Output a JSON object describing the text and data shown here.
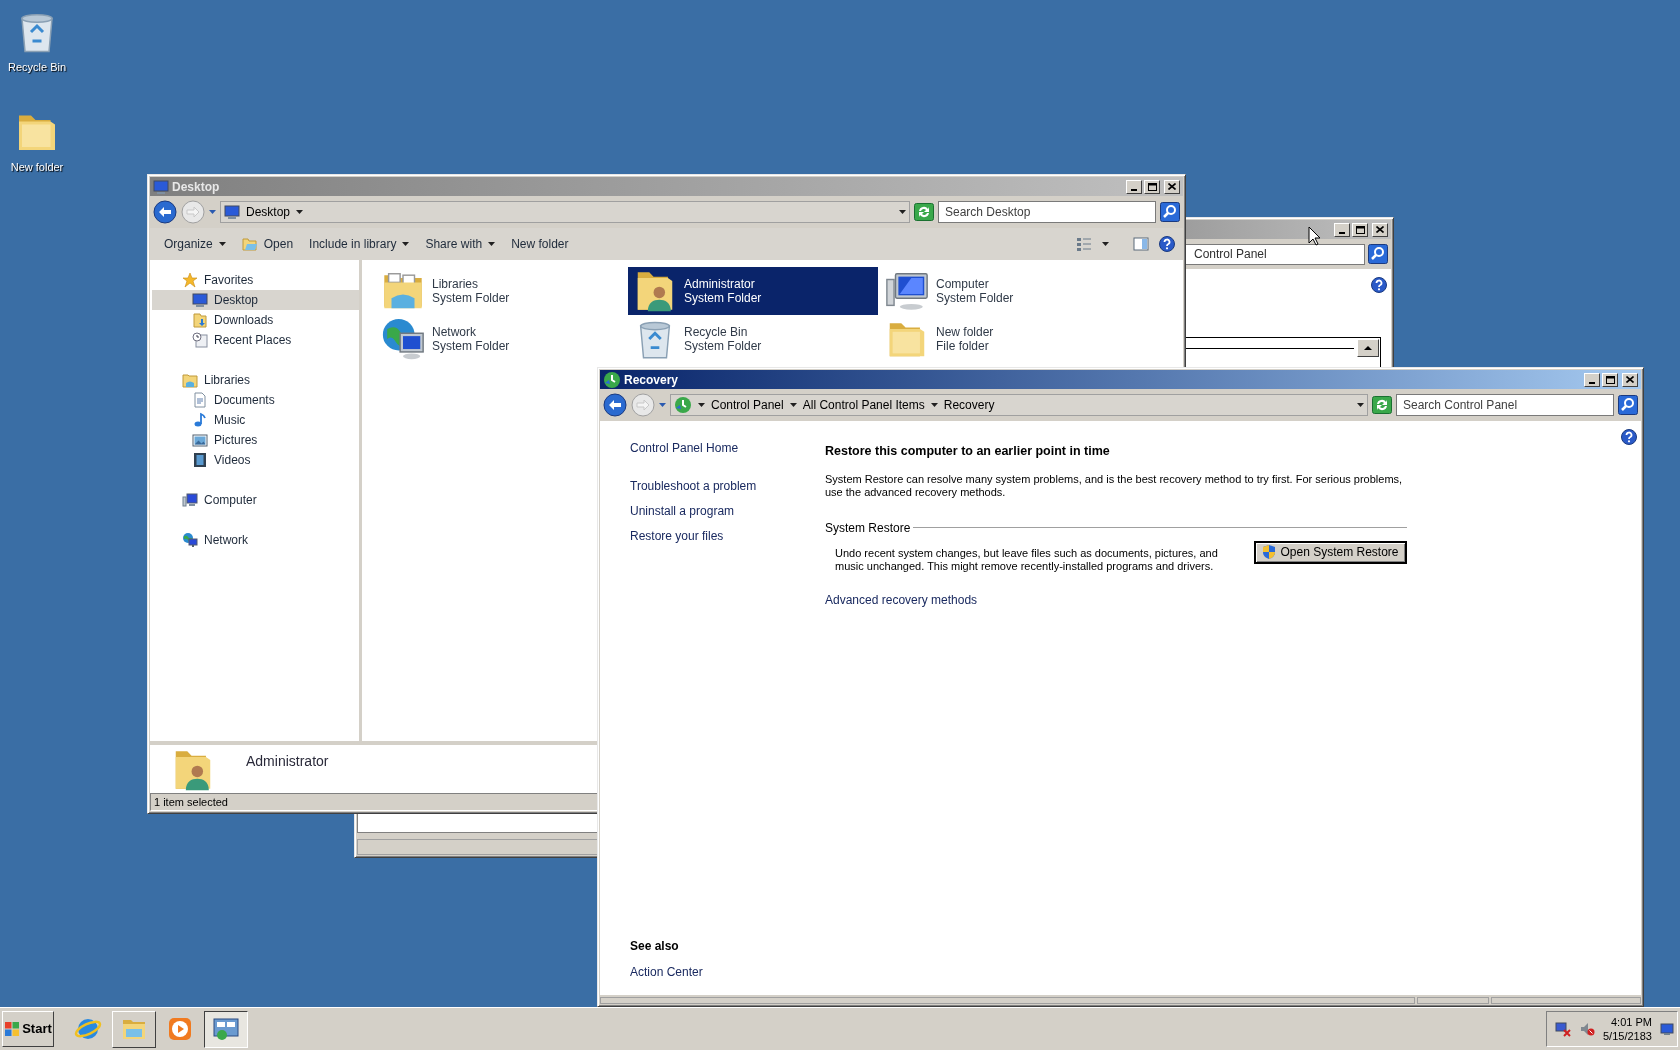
{
  "desktop_icons": [
    {
      "label": "Recycle Bin"
    },
    {
      "label": "New folder"
    }
  ],
  "background_window": {
    "search": {
      "placeholder": "Control Panel"
    }
  },
  "explorer_window": {
    "title": "Desktop",
    "active": false,
    "address": "Desktop",
    "search": {
      "placeholder": "Search Desktop"
    },
    "toolbar": [
      {
        "label": "Organize",
        "kind": "menu"
      },
      {
        "label": "Open",
        "kind": "command"
      },
      {
        "label": "Include in library",
        "kind": "menu"
      },
      {
        "label": "Share with",
        "kind": "menu"
      },
      {
        "label": "New folder",
        "kind": "plain"
      }
    ],
    "nav": [
      {
        "label": "Favorites",
        "selected": false,
        "children": [
          {
            "label": "Desktop",
            "selected": true
          },
          {
            "label": "Downloads",
            "selected": false
          },
          {
            "label": "Recent Places",
            "selected": false
          }
        ]
      },
      {
        "label": "Libraries",
        "selected": false,
        "children": [
          {
            "label": "Documents",
            "selected": false
          },
          {
            "label": "Music",
            "selected": false
          },
          {
            "label": "Pictures",
            "selected": false
          },
          {
            "label": "Videos",
            "selected": false
          }
        ]
      },
      {
        "label": "Computer",
        "selected": false
      },
      {
        "label": "Network",
        "selected": false
      }
    ],
    "items": [
      {
        "name": "Libraries",
        "type": "System Folder",
        "selected": false
      },
      {
        "name": "Administrator",
        "type": "System Folder",
        "selected": true
      },
      {
        "name": "Computer",
        "type": "System Folder",
        "selected": false
      },
      {
        "name": "Network",
        "type": "System Folder",
        "selected": false
      },
      {
        "name": "Recycle Bin",
        "type": "System Folder",
        "selected": false
      },
      {
        "name": "New folder",
        "type": "File folder",
        "selected": false
      }
    ],
    "details": {
      "name": "Administrator"
    },
    "status": "1 item selected"
  },
  "recovery_window": {
    "title": "Recovery",
    "active": true,
    "breadcrumb": [
      "Control Panel",
      "All Control Panel Items",
      "Recovery"
    ],
    "search": {
      "placeholder": "Search Control Panel"
    },
    "home_link": "Control Panel Home",
    "tasks": [
      "Troubleshoot a problem",
      "Uninstall a program",
      "Restore your files"
    ],
    "see_also": {
      "heading": "See also",
      "links": [
        "Action Center"
      ]
    },
    "heading": "Restore this computer to an earlier point in time",
    "intro": "System Restore can resolve many system problems, and is the best recovery method to try first. For serious problems, use the advanced recovery methods.",
    "section": {
      "title": "System Restore",
      "description": "Undo recent system changes, but leave files such as documents, pictures, and music unchanged. This might remove recently-installed programs and drivers.",
      "button": "Open System Restore"
    },
    "advanced_link": "Advanced recovery methods"
  },
  "taskbar": {
    "start": "Start",
    "window_buttons": [
      {
        "selected": false
      },
      {
        "selected": true
      }
    ],
    "clock": {
      "time": "4:01 PM",
      "date": "5/15/2183"
    }
  }
}
